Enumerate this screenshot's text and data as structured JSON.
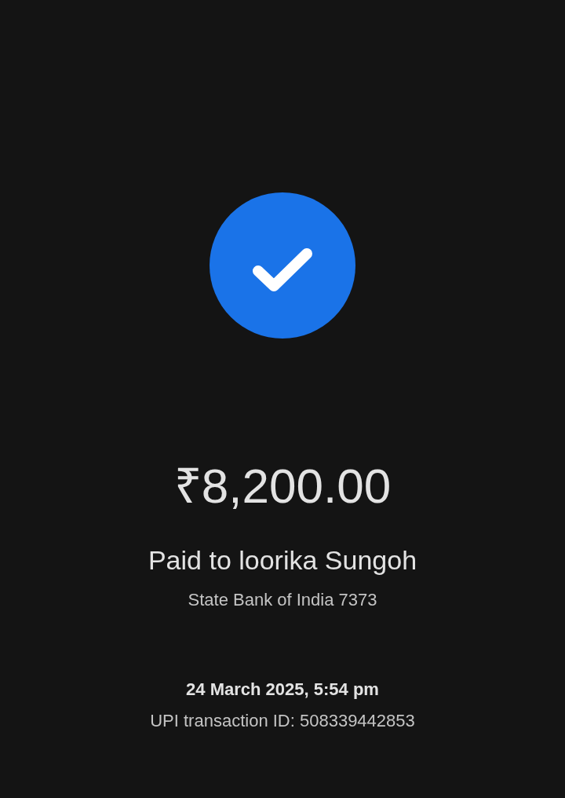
{
  "amount": "₹8,200.00",
  "payee": "Paid to loorika Sungoh",
  "bank": "State Bank of India 7373",
  "datetime": "24 March 2025, 5:54 pm",
  "transaction_id": "UPI transaction ID: 508339442853"
}
